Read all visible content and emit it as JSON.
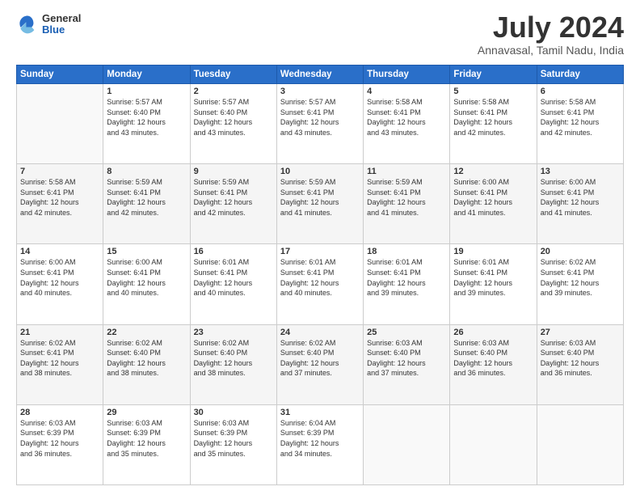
{
  "header": {
    "logo_general": "General",
    "logo_blue": "Blue",
    "month": "July 2024",
    "location": "Annavasal, Tamil Nadu, India"
  },
  "days_of_week": [
    "Sunday",
    "Monday",
    "Tuesday",
    "Wednesday",
    "Thursday",
    "Friday",
    "Saturday"
  ],
  "weeks": [
    [
      {
        "day": "",
        "info": ""
      },
      {
        "day": "1",
        "info": "Sunrise: 5:57 AM\nSunset: 6:40 PM\nDaylight: 12 hours\nand 43 minutes."
      },
      {
        "day": "2",
        "info": "Sunrise: 5:57 AM\nSunset: 6:40 PM\nDaylight: 12 hours\nand 43 minutes."
      },
      {
        "day": "3",
        "info": "Sunrise: 5:57 AM\nSunset: 6:41 PM\nDaylight: 12 hours\nand 43 minutes."
      },
      {
        "day": "4",
        "info": "Sunrise: 5:58 AM\nSunset: 6:41 PM\nDaylight: 12 hours\nand 43 minutes."
      },
      {
        "day": "5",
        "info": "Sunrise: 5:58 AM\nSunset: 6:41 PM\nDaylight: 12 hours\nand 42 minutes."
      },
      {
        "day": "6",
        "info": "Sunrise: 5:58 AM\nSunset: 6:41 PM\nDaylight: 12 hours\nand 42 minutes."
      }
    ],
    [
      {
        "day": "7",
        "info": "Sunrise: 5:58 AM\nSunset: 6:41 PM\nDaylight: 12 hours\nand 42 minutes."
      },
      {
        "day": "8",
        "info": "Sunrise: 5:59 AM\nSunset: 6:41 PM\nDaylight: 12 hours\nand 42 minutes."
      },
      {
        "day": "9",
        "info": "Sunrise: 5:59 AM\nSunset: 6:41 PM\nDaylight: 12 hours\nand 42 minutes."
      },
      {
        "day": "10",
        "info": "Sunrise: 5:59 AM\nSunset: 6:41 PM\nDaylight: 12 hours\nand 41 minutes."
      },
      {
        "day": "11",
        "info": "Sunrise: 5:59 AM\nSunset: 6:41 PM\nDaylight: 12 hours\nand 41 minutes."
      },
      {
        "day": "12",
        "info": "Sunrise: 6:00 AM\nSunset: 6:41 PM\nDaylight: 12 hours\nand 41 minutes."
      },
      {
        "day": "13",
        "info": "Sunrise: 6:00 AM\nSunset: 6:41 PM\nDaylight: 12 hours\nand 41 minutes."
      }
    ],
    [
      {
        "day": "14",
        "info": "Sunrise: 6:00 AM\nSunset: 6:41 PM\nDaylight: 12 hours\nand 40 minutes."
      },
      {
        "day": "15",
        "info": "Sunrise: 6:00 AM\nSunset: 6:41 PM\nDaylight: 12 hours\nand 40 minutes."
      },
      {
        "day": "16",
        "info": "Sunrise: 6:01 AM\nSunset: 6:41 PM\nDaylight: 12 hours\nand 40 minutes."
      },
      {
        "day": "17",
        "info": "Sunrise: 6:01 AM\nSunset: 6:41 PM\nDaylight: 12 hours\nand 40 minutes."
      },
      {
        "day": "18",
        "info": "Sunrise: 6:01 AM\nSunset: 6:41 PM\nDaylight: 12 hours\nand 39 minutes."
      },
      {
        "day": "19",
        "info": "Sunrise: 6:01 AM\nSunset: 6:41 PM\nDaylight: 12 hours\nand 39 minutes."
      },
      {
        "day": "20",
        "info": "Sunrise: 6:02 AM\nSunset: 6:41 PM\nDaylight: 12 hours\nand 39 minutes."
      }
    ],
    [
      {
        "day": "21",
        "info": "Sunrise: 6:02 AM\nSunset: 6:41 PM\nDaylight: 12 hours\nand 38 minutes."
      },
      {
        "day": "22",
        "info": "Sunrise: 6:02 AM\nSunset: 6:40 PM\nDaylight: 12 hours\nand 38 minutes."
      },
      {
        "day": "23",
        "info": "Sunrise: 6:02 AM\nSunset: 6:40 PM\nDaylight: 12 hours\nand 38 minutes."
      },
      {
        "day": "24",
        "info": "Sunrise: 6:02 AM\nSunset: 6:40 PM\nDaylight: 12 hours\nand 37 minutes."
      },
      {
        "day": "25",
        "info": "Sunrise: 6:03 AM\nSunset: 6:40 PM\nDaylight: 12 hours\nand 37 minutes."
      },
      {
        "day": "26",
        "info": "Sunrise: 6:03 AM\nSunset: 6:40 PM\nDaylight: 12 hours\nand 36 minutes."
      },
      {
        "day": "27",
        "info": "Sunrise: 6:03 AM\nSunset: 6:40 PM\nDaylight: 12 hours\nand 36 minutes."
      }
    ],
    [
      {
        "day": "28",
        "info": "Sunrise: 6:03 AM\nSunset: 6:39 PM\nDaylight: 12 hours\nand 36 minutes."
      },
      {
        "day": "29",
        "info": "Sunrise: 6:03 AM\nSunset: 6:39 PM\nDaylight: 12 hours\nand 35 minutes."
      },
      {
        "day": "30",
        "info": "Sunrise: 6:03 AM\nSunset: 6:39 PM\nDaylight: 12 hours\nand 35 minutes."
      },
      {
        "day": "31",
        "info": "Sunrise: 6:04 AM\nSunset: 6:39 PM\nDaylight: 12 hours\nand 34 minutes."
      },
      {
        "day": "",
        "info": ""
      },
      {
        "day": "",
        "info": ""
      },
      {
        "day": "",
        "info": ""
      }
    ]
  ]
}
